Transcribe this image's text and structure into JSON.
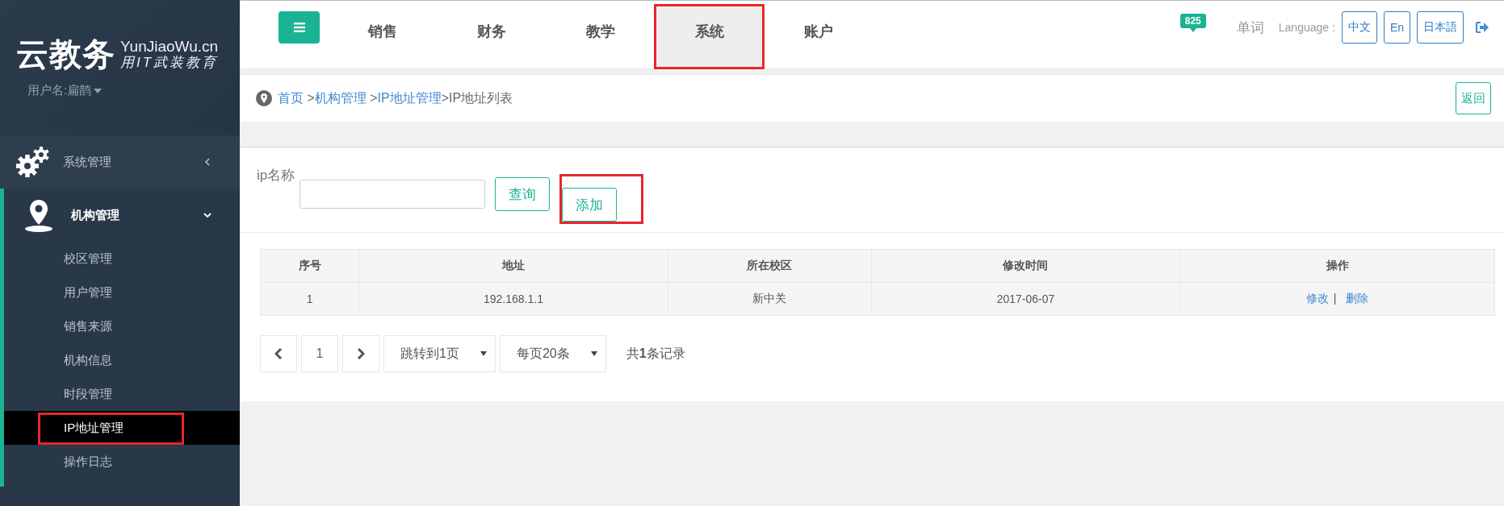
{
  "sidebar": {
    "logo": {
      "title": "云教务",
      "domain": "YunJiaoWu.cn",
      "slogan": "用IT武装教育"
    },
    "user": "用户名:扁鹊",
    "menu": [
      {
        "label": "系统管理",
        "expanded": false
      },
      {
        "label": "机构管理",
        "expanded": true,
        "children": [
          {
            "label": "校区管理",
            "selected": false,
            "highlighted": false
          },
          {
            "label": "用户管理",
            "selected": false,
            "highlighted": false
          },
          {
            "label": "销售来源",
            "selected": false,
            "highlighted": false
          },
          {
            "label": "机构信息",
            "selected": false,
            "highlighted": false
          },
          {
            "label": "时段管理",
            "selected": false,
            "highlighted": false
          },
          {
            "label": "IP地址管理",
            "selected": true,
            "highlighted": true
          },
          {
            "label": "操作日志",
            "selected": false,
            "highlighted": false
          }
        ]
      }
    ]
  },
  "topbar": {
    "tabs": [
      {
        "label": "销售",
        "selected": false,
        "highlighted": false
      },
      {
        "label": "财务",
        "selected": false,
        "highlighted": false
      },
      {
        "label": "教学",
        "selected": false,
        "highlighted": false
      },
      {
        "label": "系统",
        "selected": true,
        "highlighted": true
      },
      {
        "label": "账户",
        "selected": false,
        "highlighted": false
      }
    ],
    "badge": "825",
    "words": "单词",
    "language_label": "Language :",
    "languages": [
      "中文",
      "En",
      "日本語"
    ]
  },
  "breadcrumb": [
    {
      "text": "首页",
      "kind": "link"
    },
    {
      "text": " >",
      "kind": "separator"
    },
    {
      "text": "机构管理",
      "kind": "link"
    },
    {
      "text": " >",
      "kind": "separator"
    },
    {
      "text": "IP地址管理",
      "kind": "link"
    },
    {
      "text": ">IP地址列表",
      "kind": "current"
    }
  ],
  "back_button": "返回",
  "search": {
    "label": "ip名称",
    "buttons": [
      {
        "label": "查询",
        "highlighted": false
      },
      {
        "label": "添加",
        "highlighted": true
      }
    ]
  },
  "table": {
    "columns": [
      "序号",
      "地址",
      "所在校区",
      "修改时间",
      "操作"
    ],
    "rows": [
      {
        "cells": [
          "1",
          "192.168.1.1",
          "新中关",
          "2017-06-07"
        ],
        "actions": [
          "修改",
          "删除"
        ],
        "action_separator": "|"
      }
    ]
  },
  "pagination": {
    "page": "1",
    "jump": "跳转到1页",
    "per_page": "每页20条",
    "total": "共**1**条记录"
  }
}
